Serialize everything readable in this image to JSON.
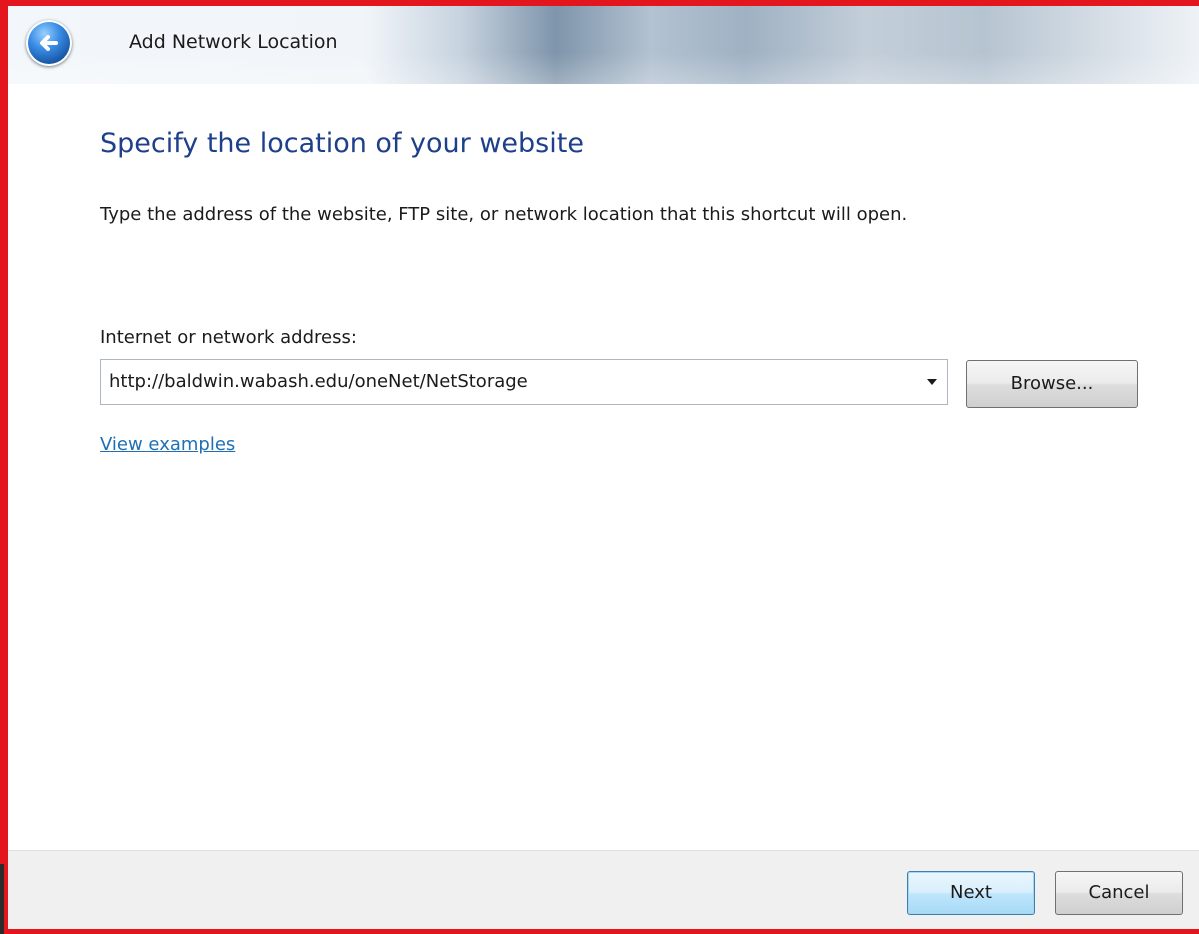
{
  "window": {
    "title": "Add Network Location"
  },
  "main": {
    "heading": "Specify the location of your website",
    "description": "Type the address of the website, FTP site, or network location that this shortcut will open.",
    "address_label": "Internet or network address:",
    "address_value": "http://baldwin.wabash.edu/oneNet/NetStorage",
    "browse_label": "Browse...",
    "examples_link": "View examples"
  },
  "footer": {
    "next_label": "Next",
    "cancel_label": "Cancel"
  },
  "icons": {
    "back": "back-arrow-icon",
    "dropdown": "chevron-down-icon"
  },
  "colors": {
    "frame_border": "#e3151d",
    "heading": "#1e3f8a",
    "link": "#1f6fb4",
    "footer_bg": "#f0f0f0"
  }
}
